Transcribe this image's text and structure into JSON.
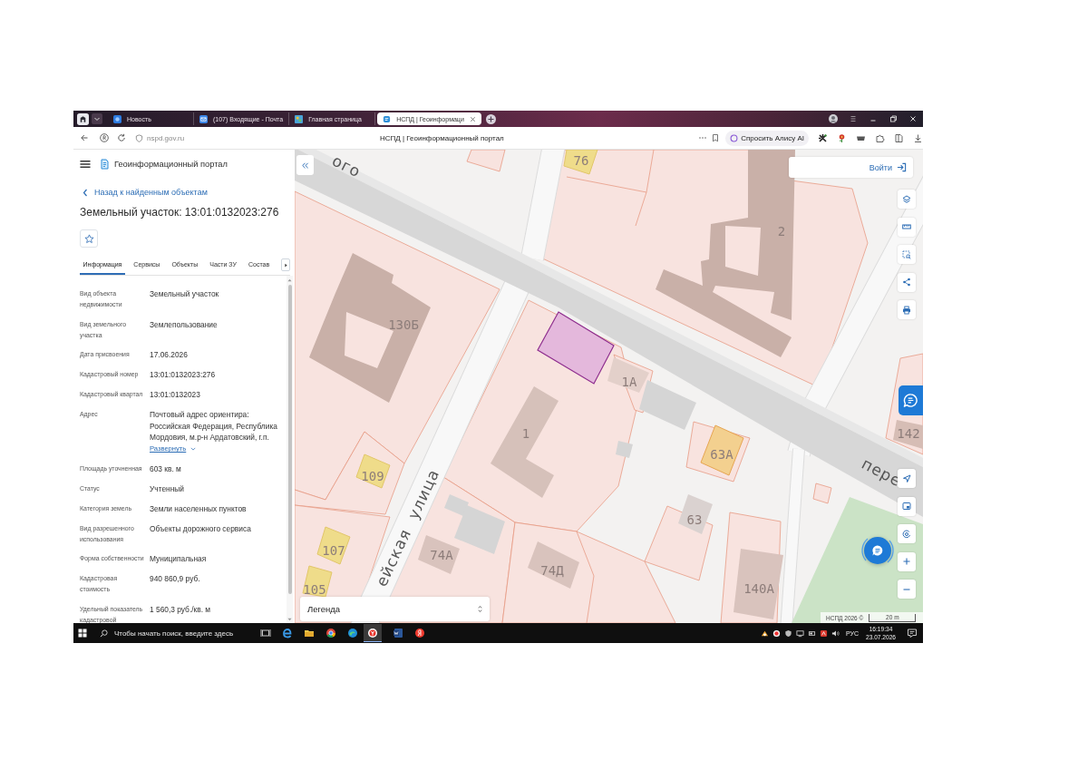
{
  "browser": {
    "tabs": [
      {
        "title": "Новость",
        "selected": false
      },
      {
        "title": "(107) Входящие - Почта",
        "selected": false
      },
      {
        "title": "Главная страница",
        "selected": false
      },
      {
        "title": "НСПД | Геоинформаци",
        "selected": true
      }
    ],
    "url": "nspd.gov.ru",
    "page_title": "НСПД | Геоинформационный портал",
    "assistant_button": "Спросить Алису AI"
  },
  "sidebar": {
    "portal_name": "Геоинформационный портал",
    "back_link": "Назад к найденным объектам",
    "title": "Земельный участок: 13:01:0132023:276",
    "favorite": false,
    "tabs": [
      {
        "label": "Информация",
        "selected": true
      },
      {
        "label": "Сервисы",
        "selected": false
      },
      {
        "label": "Объекты",
        "selected": false
      },
      {
        "label": "Части ЗУ",
        "selected": false
      },
      {
        "label": "Состав",
        "selected": false
      }
    ],
    "fields": [
      {
        "label": "Вид объекта недвижимости",
        "value": "Земельный участок"
      },
      {
        "label": "Вид земельного участка",
        "value": "Землепользование"
      },
      {
        "label": "Дата присвоения",
        "value": "17.06.2026"
      },
      {
        "label": "Кадастровый номер",
        "value": "13:01:0132023:276"
      },
      {
        "label": "Кадастровый квартал",
        "value": "13:01:0132023"
      },
      {
        "label": "Адрес",
        "value": "Почтовый адрес ориентира: Российская Федерация, Республика Мордовия, м.р-н Ардатовский, г.п.",
        "link": "Развернуть"
      },
      {
        "label": "Площадь уточненная",
        "value": "603 кв. м"
      },
      {
        "label": "Статус",
        "value": "Учтенный"
      },
      {
        "label": "Категория земель",
        "value": "Земли населенных пунктов"
      },
      {
        "label": "Вид разрешенного использования",
        "value": "Объекты дорожного сервиса"
      },
      {
        "label": "Форма собственности",
        "value": "Муниципальная"
      },
      {
        "label": "Кадастровая стоимость",
        "value": "940 860,9 руб."
      },
      {
        "label": "Удельный показатель кадастровой",
        "value": "1 560,3 руб./кв. м"
      }
    ]
  },
  "map": {
    "login_button": "Войти",
    "labels": [
      {
        "text": "ого",
        "kind": "street"
      },
      {
        "text": "76",
        "kind": "house"
      },
      {
        "text": "2",
        "kind": "house"
      },
      {
        "text": "130Б",
        "kind": "house"
      },
      {
        "text": "1А",
        "kind": "house"
      },
      {
        "text": "1",
        "kind": "house"
      },
      {
        "text": "142",
        "kind": "house"
      },
      {
        "text": "63А",
        "kind": "house"
      },
      {
        "text": "пере",
        "kind": "street"
      },
      {
        "text": "109",
        "kind": "house"
      },
      {
        "text": "63",
        "kind": "house"
      },
      {
        "text": "ейская",
        "kind": "street"
      },
      {
        "text": "улица",
        "kind": "street"
      },
      {
        "text": "107",
        "kind": "house"
      },
      {
        "text": "74А",
        "kind": "house"
      },
      {
        "text": "74Д",
        "kind": "house"
      },
      {
        "text": "140А",
        "kind": "house"
      },
      {
        "text": "105",
        "kind": "house"
      }
    ],
    "legend": "Легенда",
    "attribution": "НСПД 2026 ©",
    "scale": "20 m"
  },
  "taskbar": {
    "search_placeholder": "Чтобы начать поиск, введите здесь",
    "language": "РУС",
    "time": "16:19:34",
    "date": "23.07.2026"
  }
}
